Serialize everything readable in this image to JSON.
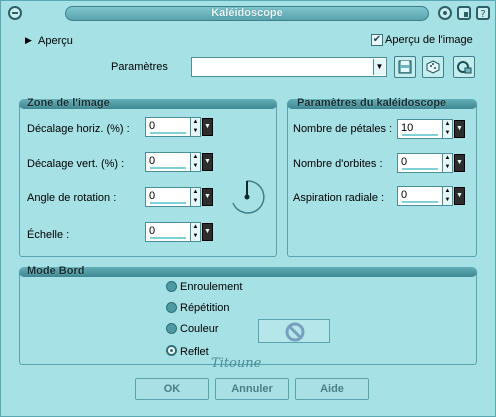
{
  "window": {
    "title": "Kaléidoscope"
  },
  "preview": {
    "label": "Aperçu",
    "checkbox_label": "Aperçu de l'image",
    "checked": true
  },
  "presets": {
    "label": "Paramètres",
    "value": ""
  },
  "zone": {
    "title": "Zone de l'image",
    "fields": [
      {
        "label": "Décalage horiz. (%) :",
        "value": "0"
      },
      {
        "label": "Décalage vert. (%) :",
        "value": "0"
      },
      {
        "label": "Angle de rotation :",
        "value": "0"
      },
      {
        "label": "Échelle :",
        "value": "0"
      }
    ]
  },
  "params": {
    "title": "Paramètres du kaléidoscope",
    "fields": [
      {
        "label": "Nombre de pétales :",
        "value": "10"
      },
      {
        "label": "Nombre d'orbites :",
        "value": "0"
      },
      {
        "label": "Aspiration radiale :",
        "value": "0"
      }
    ]
  },
  "mode": {
    "title": "Mode Bord",
    "options": [
      {
        "label": "Enroulement",
        "selected": false
      },
      {
        "label": "Répétition",
        "selected": false
      },
      {
        "label": "Couleur",
        "selected": false
      },
      {
        "label": "Reflet",
        "selected": true
      }
    ]
  },
  "buttons": {
    "ok": "OK",
    "cancel": "Annuler",
    "help": "Aide"
  },
  "signature": "Titoune",
  "icons": {
    "titlebar_left": "window-menu-icon",
    "titlebar_right": [
      "circle-icon",
      "save-preset-icon",
      "help-icon"
    ],
    "preset_tools": [
      "save-icon",
      "random-dice-icon",
      "reset-icon"
    ],
    "no_color": "no-color-icon"
  },
  "colors": {
    "background": "#a6e1e6",
    "accent": "#5aa3ad",
    "text": "#000000"
  }
}
